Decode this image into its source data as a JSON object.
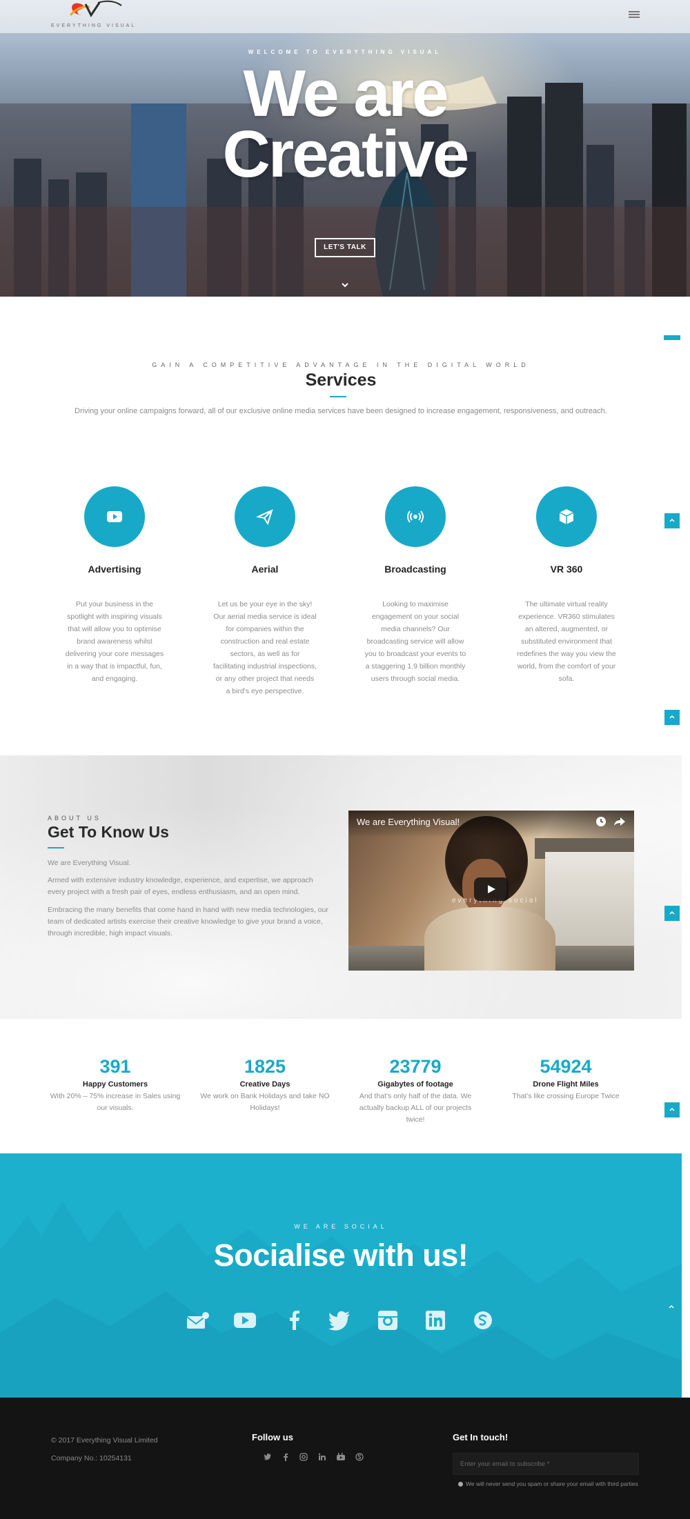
{
  "colors": {
    "accent": "#18a9c9",
    "social_bg": "#1cb0cd",
    "footer_bg": "#141414"
  },
  "header": {
    "logo_text": "EVERYTHING VISUAL",
    "menu_icon": "hamburger-icon"
  },
  "hero": {
    "eyebrow": "WELCOME TO EVERYTHING VISUAL",
    "title_line1": "We are",
    "title_line2": "Creative",
    "button_label": "LET'S TALK",
    "scroll_icon": "chevron-down-icon"
  },
  "services": {
    "eyebrow": "GAIN A COMPETITIVE ADVANTAGE IN THE DIGITAL WORLD",
    "title": "Services",
    "intro": "Driving your online campaigns forward, all of our exclusive online media services have been designed to increase engagement, responsiveness, and outreach.",
    "items": [
      {
        "name": "Advertising",
        "icon": "play-icon",
        "desc": "Put your business in the spotlight with inspiring visuals that will allow you to optimise brand awareness whilst delivering your core messages in a way that is impactful, fun, and engaging."
      },
      {
        "name": "Aerial",
        "icon": "paper-plane-icon",
        "desc": "Let us be your eye in the sky! Our aerial media service is ideal for companies within the construction and real estate sectors, as well as for facilitating industrial inspections, or any other project that needs a bird's eye perspective."
      },
      {
        "name": "Broadcasting",
        "icon": "broadcast-icon",
        "desc": "Looking to maximise engagement on your social media channels? Our broadcasting service will allow you to broadcast your events to a staggering 1.9 billion monthly users through social media."
      },
      {
        "name": "VR 360",
        "icon": "cube-icon",
        "desc": "The ultimate virtual reality experience. VR360 stimulates an altered, augmented, or substituted environment that redefines the way you view the world, from the comfort of your sofa."
      }
    ]
  },
  "about": {
    "eyebrow": "ABOUT US",
    "title": "Get To Know Us",
    "p1": "We are Everything Visual.",
    "p2": "Armed with extensive industry knowledge, experience, and expertise, we approach every project with a fresh pair of eyes, endless enthusiasm, and an open mind.",
    "p3": "Embracing the many benefits that come hand in hand with new media technologies, our team of dedicated artists exercise their creative knowledge to give your brand a voice, through incredible, high impact visuals.",
    "video": {
      "title": "We are Everything Visual!",
      "watermark": "everything social"
    }
  },
  "stats": [
    {
      "number": "391",
      "label": "Happy Customers",
      "desc": "With 20% – 75% increase in Sales using our visuals."
    },
    {
      "number": "1825",
      "label": "Creative Days",
      "desc": "We work on Bank Holidays and take NO Holidays!"
    },
    {
      "number": "23779",
      "label": "Gigabytes of footage",
      "desc": "And that's only half of the data. We actually backup ALL of our projects twice!"
    },
    {
      "number": "54924",
      "label": "Drone Flight Miles",
      "desc": "That's like crossing Europe  Twice"
    }
  ],
  "social": {
    "eyebrow": "WE ARE SOCIAL",
    "title": "Socialise with us!",
    "icons": [
      "email-icon",
      "youtube-icon",
      "facebook-icon",
      "twitter-icon",
      "instagram-icon",
      "linkedin-icon",
      "skype-icon"
    ]
  },
  "footer": {
    "copyright": "© 2017 Everything Visual Limited",
    "company": "Company No.: 10254131",
    "follow_title": "Follow us",
    "follow_icons": [
      "twitter-icon",
      "facebook-icon",
      "instagram-icon",
      "linkedin-icon",
      "youtube-icon",
      "skype-icon"
    ],
    "contact_title": "Get In touch!",
    "email_placeholder": "Enter your email to subscribe *",
    "note": "We will never send you spam or share your email with third parties"
  }
}
